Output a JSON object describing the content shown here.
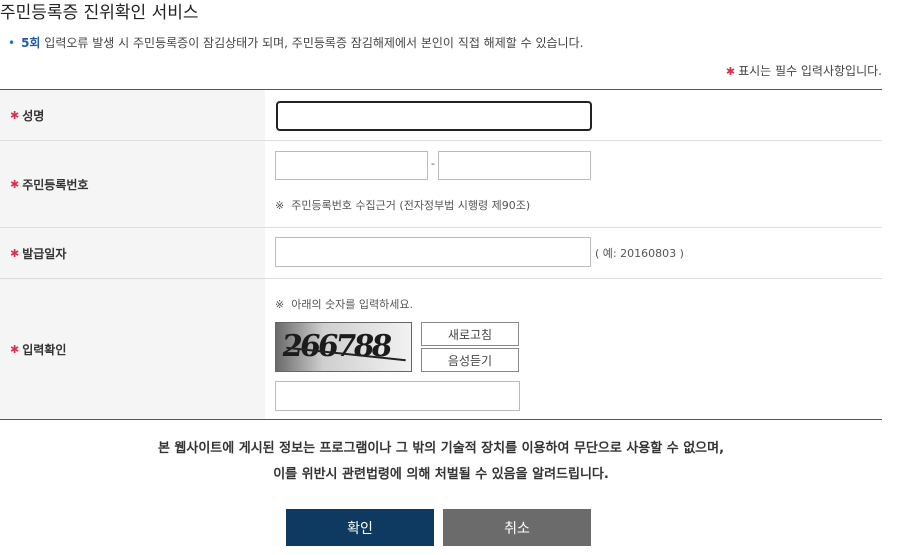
{
  "page": {
    "title": "주민등록증 진위확인 서비스",
    "notice": {
      "count": "5회",
      "text": " 입력오류 발생 시 주민등록증이 잠김상태가 되며, 주민등록증 잠김해제에서 본인이 직접 해제할 수 있습니다."
    },
    "required_note": "표시는 필수 입력사항입니다.",
    "required_mark": "✱"
  },
  "form": {
    "name_label": "성명",
    "rrn_label": "주민등록번호",
    "rrn_separator": "-",
    "rrn_note": "※  주민등록번호 수집근거 (전자정부법 시행령 제90조)",
    "issue_label": "발급일자",
    "issue_example": "( 예: 20160803 )",
    "captcha_label": "입력확인",
    "captcha_note": "※  아래의 숫자를 입력하세요.",
    "captcha_code": "266788",
    "refresh_label": "새로고침",
    "audio_label": "음성듣기"
  },
  "footer": {
    "line1": "본 웹사이트에 게시된 정보는 프로그램이나 그 밖의 기술적 장치를 이용하여 무단으로 사용할 수 없으며,",
    "line2": "이를 위반시 관련법령에 의해 처벌될 수 있음을 알려드립니다.",
    "confirm_label": "확인",
    "cancel_label": "취소",
    "confirm_color": "#0e3a62",
    "cancel_color": "#6b6b6b"
  }
}
